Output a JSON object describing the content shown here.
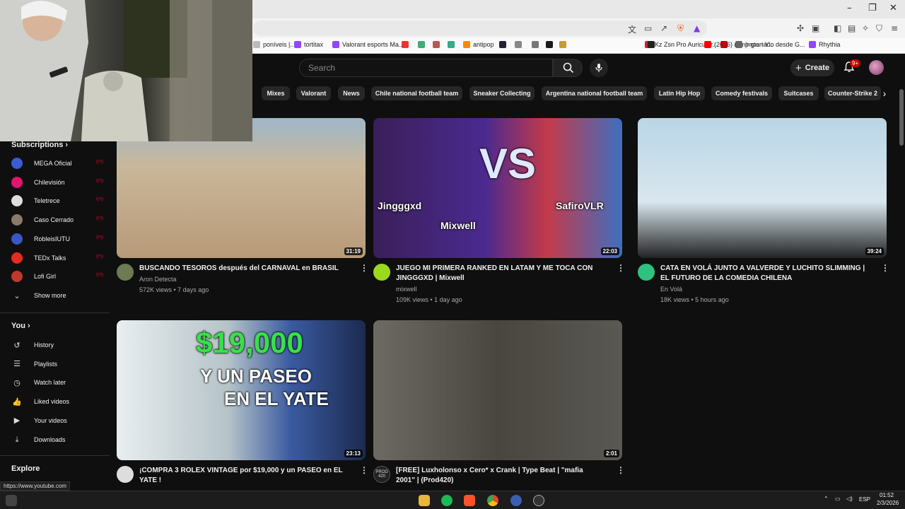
{
  "browser": {
    "bookmarks": [
      {
        "label": "poníveis |...",
        "color": "#bbb"
      },
      {
        "label": "tortitax",
        "color": "#9146ff"
      },
      {
        "label": "Valorant esports Ma...",
        "color": "#9146ff"
      },
      {
        "label": "",
        "color": "#e33"
      },
      {
        "label": "",
        "color": "#4a7"
      },
      {
        "label": "",
        "color": "#b55"
      },
      {
        "label": "",
        "color": "#3a8"
      },
      {
        "label": "antipop",
        "color": "#f80"
      },
      {
        "label": "",
        "color": "#223"
      },
      {
        "label": "",
        "color": "#888"
      },
      {
        "label": "",
        "color": "#777"
      },
      {
        "label": "",
        "color": "#1a1a1a"
      },
      {
        "label": "",
        "color": "#c93"
      },
      {
        "label": "Kz Zsn Pro Auricular...",
        "color": "#c22"
      },
      {
        "label": "",
        "color": "#222"
      },
      {
        "label": "(2686) ramp gta - Y...",
        "color": "#f00"
      },
      {
        "label": "",
        "color": "#b01"
      },
      {
        "label": "Importado desde G...",
        "color": "#666"
      },
      {
        "label": "Rhythia",
        "color": "#9146ff"
      }
    ]
  },
  "header": {
    "search_placeholder": "Search",
    "create_label": "Create",
    "notification_count": "9+"
  },
  "chips": [
    "Mixes",
    "Valorant",
    "News",
    "Chile national football team",
    "Sneaker Collecting",
    "Argentina national football team",
    "Latin Hip Hop",
    "Comedy festivals",
    "Suitcases",
    "Counter-Strike 2"
  ],
  "sidebar": {
    "subscriptions_title": "Subscriptions",
    "subscriptions": [
      {
        "label": "MEGA Oficial",
        "color": "#3b5bd6"
      },
      {
        "label": "Chilevisión",
        "color": "#e0156c"
      },
      {
        "label": "Teletrece",
        "color": "#ddd"
      },
      {
        "label": "Caso Cerrado",
        "color": "#8a7a6a"
      },
      {
        "label": "RobleisIUTU",
        "color": "#3a56c8"
      },
      {
        "label": "TEDx Talks",
        "color": "#e62b1e"
      },
      {
        "label": "Lofi Girl",
        "color": "#c0392b"
      }
    ],
    "show_more": "Show more",
    "you_title": "You",
    "you_items": [
      {
        "label": "History",
        "icon": "history-icon",
        "glyph": "↺"
      },
      {
        "label": "Playlists",
        "icon": "playlists-icon",
        "glyph": "☰"
      },
      {
        "label": "Watch later",
        "icon": "watch-later-icon",
        "glyph": "◷"
      },
      {
        "label": "Liked videos",
        "icon": "like-icon",
        "glyph": "👍"
      },
      {
        "label": "Your videos",
        "icon": "your-videos-icon",
        "glyph": "▶"
      },
      {
        "label": "Downloads",
        "icon": "downloads-icon",
        "glyph": "⤓"
      }
    ],
    "explore_title": "Explore"
  },
  "videos": [
    {
      "title": "BUSCANDO TESOROS después del CARNAVAL en BRASIL",
      "channel": "Aron Detecta",
      "meta": "572K views • 7 days ago",
      "duration": "31:19",
      "avatar": "#6d7a52"
    },
    {
      "title": "JUEGO MI PRIMERA RANKED EN LATAM Y ME TOCA CON JINGGGXD | Mixwell",
      "channel": "mixwell",
      "meta": "109K views • 1 day ago",
      "duration": "22:03",
      "avatar": "#9ad91e",
      "overlay": [
        "Jingggxd",
        "Mixwell",
        "SafiroVLR"
      ]
    },
    {
      "title": "CATA EN VOLÁ JUNTO A VALVERDE Y LUCHITO SLIMMING | EL FUTURO DE LA COMEDIA CHILENA",
      "channel": "En Volá",
      "meta": "18K views • 5 hours ago",
      "duration": "39:24",
      "avatar": "#2ec27e"
    },
    {
      "title": "¡COMPRA 3 ROLEX VINTAGE por $19,000 y un PASEO en EL YATE !",
      "channel": "",
      "meta": "",
      "duration": "23:13",
      "avatar": "#ddd",
      "overlay": [
        "$19,000",
        "Y UN PASEO",
        "EN EL YATE"
      ]
    },
    {
      "title": "[FREE] Luxholonso x Cero* x Crank | Type Beat | \"mafia 2001\" | (Prod420)",
      "channel": "",
      "meta": "",
      "duration": "2:01",
      "avatar": "#222",
      "avatar_text": "PROD 420"
    }
  ],
  "status_url": "https://www.youtube.com",
  "taskbar": {
    "lang": "ESP",
    "time": "01:52",
    "date": "2/3/2026"
  }
}
